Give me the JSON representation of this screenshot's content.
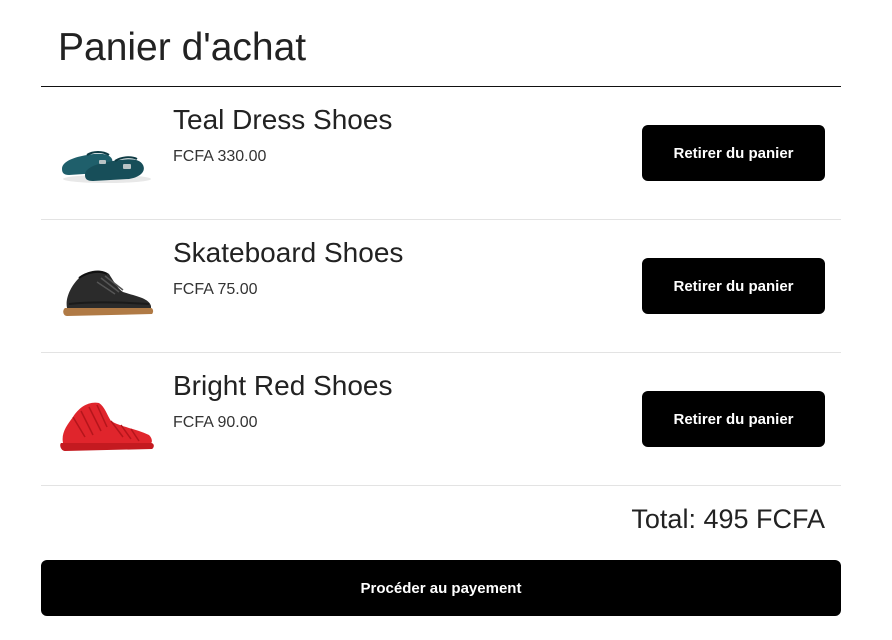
{
  "page": {
    "title": "Panier d'achat"
  },
  "cart": {
    "items": [
      {
        "name": "Teal Dress Shoes",
        "price": "FCFA 330.00",
        "remove_label": "Retirer du panier",
        "image_icon": "teal-dress-shoes-image",
        "color": "#1f5f6b"
      },
      {
        "name": "Skateboard Shoes",
        "price": "FCFA 75.00",
        "remove_label": "Retirer du panier",
        "image_icon": "skateboard-shoes-image",
        "color": "#2b2b2b"
      },
      {
        "name": "Bright Red Shoes",
        "price": "FCFA 90.00",
        "remove_label": "Retirer du panier",
        "image_icon": "bright-red-shoes-image",
        "color": "#e0252c"
      }
    ],
    "total": "Total: 495 FCFA",
    "checkout_label": "Procéder au payement"
  },
  "colors": {
    "button_bg": "#000000",
    "button_text": "#ffffff",
    "divider": "#e3e3e3",
    "title_rule": "#111111"
  }
}
